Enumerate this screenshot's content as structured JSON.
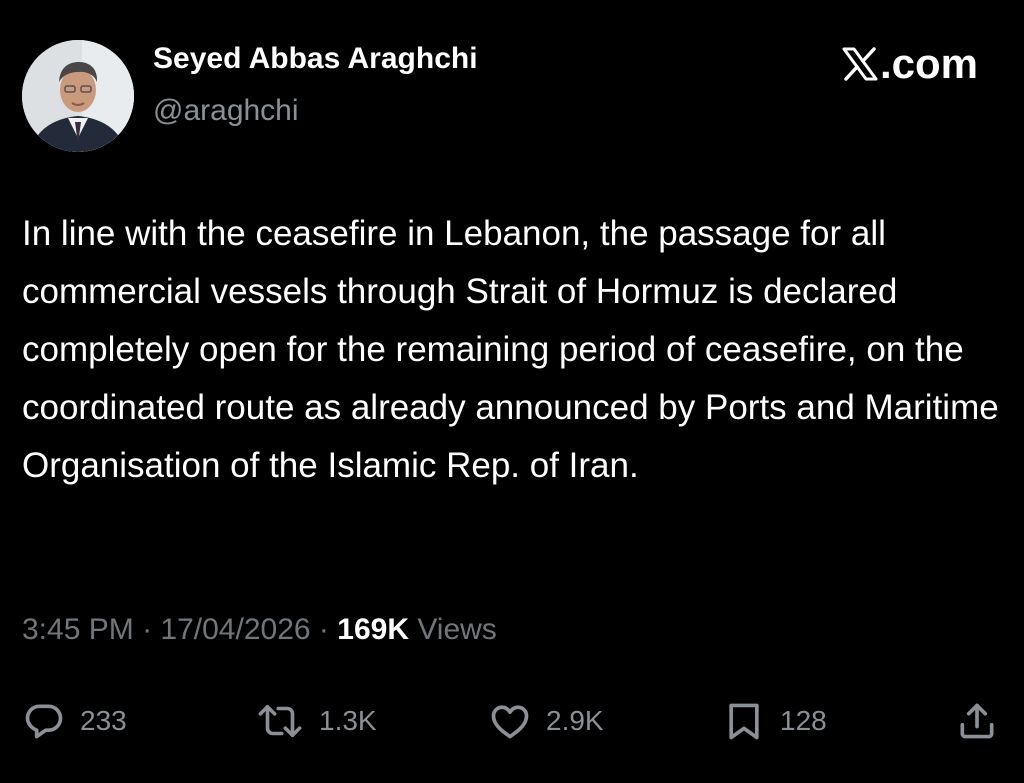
{
  "author": {
    "name": "Seyed Abbas Araghchi",
    "handle": "@araghchi"
  },
  "brand": {
    "label": ".com"
  },
  "tweet": {
    "text": "In line with the ceasefire in Lebanon, the passage for all commercial vessels through Strait of Hormuz is declared completely open for the remaining period of ceasefire, on the coordinated route as already announced by Ports and Maritime Organisation of the Islamic Rep. of Iran.",
    "time": "3:45 PM",
    "separator": "·",
    "date": "17/04/2026",
    "views_count": "169K",
    "views_label": "Views"
  },
  "actions": {
    "replies": "233",
    "reposts": "1.3K",
    "likes": "2.9K",
    "bookmarks": "128"
  },
  "icons": {
    "reply": "speech-bubble-icon",
    "repost": "repost-arrows-icon",
    "like": "heart-icon",
    "bookmark": "bookmark-icon",
    "share": "share-upload-icon",
    "brand": "x-logo-icon"
  },
  "colors": {
    "background": "#000000",
    "primary_text": "#ffffff",
    "secondary_text": "#71767b"
  }
}
